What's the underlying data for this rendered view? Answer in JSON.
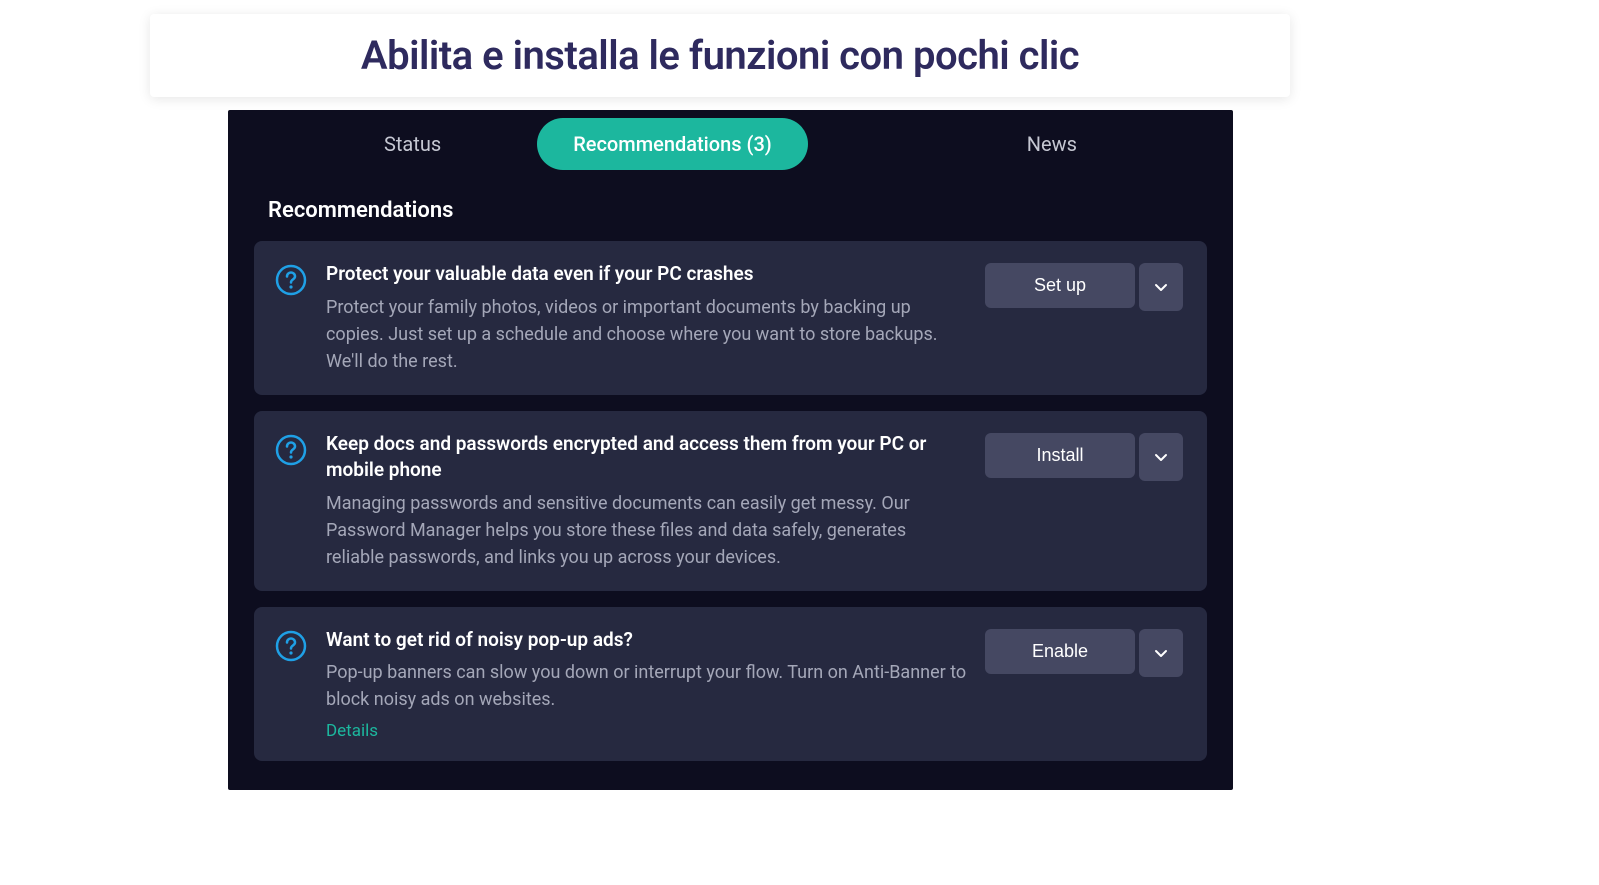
{
  "banner": {
    "text": "Abilita e installa le funzioni con pochi clic"
  },
  "tabs": {
    "status": "Status",
    "recommendations": "Recommendations (3)",
    "news": "News"
  },
  "section": {
    "title": "Recommendations"
  },
  "recommendations": [
    {
      "title": "Protect your valuable data even if your PC crashes",
      "description": "Protect your family photos, videos or important documents by backing up copies. Just set up a schedule and choose where you want to store backups. We'll do the rest.",
      "action": "Set up",
      "details": null
    },
    {
      "title": "Keep docs and passwords encrypted and access them from your PC or mobile phone",
      "description": "Managing passwords and sensitive documents can easily get messy. Our Password Manager helps you store these files and data safely, generates reliable passwords, and links you up across your devices.",
      "action": "Install",
      "details": null
    },
    {
      "title": "Want to get rid of noisy pop-up ads?",
      "description": "Pop-up banners can slow you down or interrupt your flow. Turn on Anti-Banner to block noisy ads on websites.",
      "action": "Enable",
      "details": "Details"
    }
  ]
}
